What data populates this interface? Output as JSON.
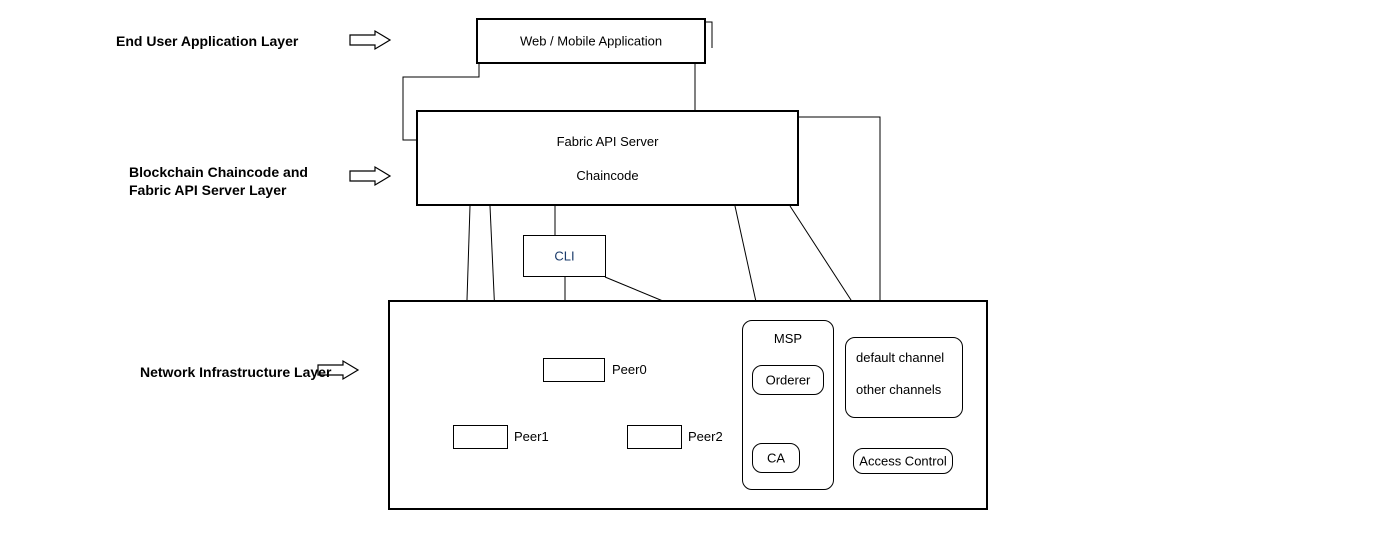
{
  "layers": {
    "end_user": "End User Application Layer",
    "chaincode": "Blockchain Chaincode and\nFabric API Server Layer",
    "network": "Network Infrastructure Layer"
  },
  "nodes": {
    "web_mobile": "Web / Mobile Application",
    "fabric_api": "Fabric API Server",
    "chaincode": "Chaincode",
    "cli": "CLI",
    "peer0": "Peer0",
    "peer1": "Peer1",
    "peer2": "Peer2",
    "msp": "MSP",
    "orderer": "Orderer",
    "ca": "CA",
    "default_channel": "default channel",
    "other_channels": "other channels",
    "access_control": "Access Control"
  }
}
